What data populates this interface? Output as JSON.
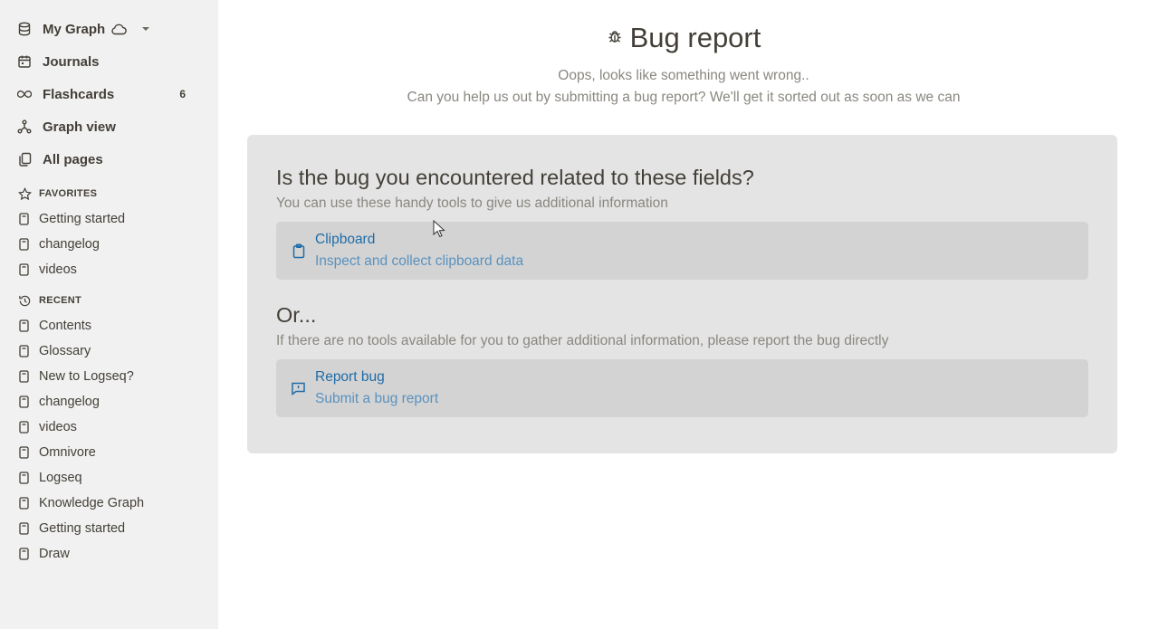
{
  "sidebar": {
    "graph": {
      "name": "My Graph",
      "icon": "database-icon"
    },
    "nav": [
      {
        "label": "Journals",
        "icon": "calendar-icon"
      },
      {
        "label": "Flashcards",
        "icon": "infinity-icon",
        "count": "6"
      },
      {
        "label": "Graph view",
        "icon": "graph-icon"
      },
      {
        "label": "All pages",
        "icon": "pages-icon"
      }
    ],
    "favorites": {
      "heading": "FAVORITES",
      "items": [
        "Getting started",
        "changelog",
        "videos"
      ]
    },
    "recent": {
      "heading": "RECENT",
      "items": [
        "Contents",
        "Glossary",
        "New to Logseq?",
        "changelog",
        "videos",
        "Omnivore",
        "Logseq",
        "Knowledge Graph",
        "Getting started",
        "Draw"
      ]
    }
  },
  "main": {
    "title": "Bug report",
    "subtitle_line1": "Oops, looks like something went wrong..",
    "subtitle_line2": "Can you help us out by submitting a bug report? We'll get it sorted out as soon as we can",
    "fields_heading": "Is the bug you encountered related to these fields?",
    "fields_desc": "You can use these handy tools to give us additional information",
    "clipboard_tool": {
      "title": "Clipboard",
      "subtitle": "Inspect and collect clipboard data"
    },
    "or_heading": "Or...",
    "or_desc": "If there are no tools available for you to gather additional information, please report the bug directly",
    "report_tool": {
      "title": "Report bug",
      "subtitle": "Submit a bug report"
    }
  },
  "colors": {
    "sidebar_bg": "#f1f1f1",
    "panel_bg": "#e4e4e4",
    "tool_bg": "#d3d3d3",
    "link": "#1f6ca8",
    "muted": "#8a8780"
  }
}
